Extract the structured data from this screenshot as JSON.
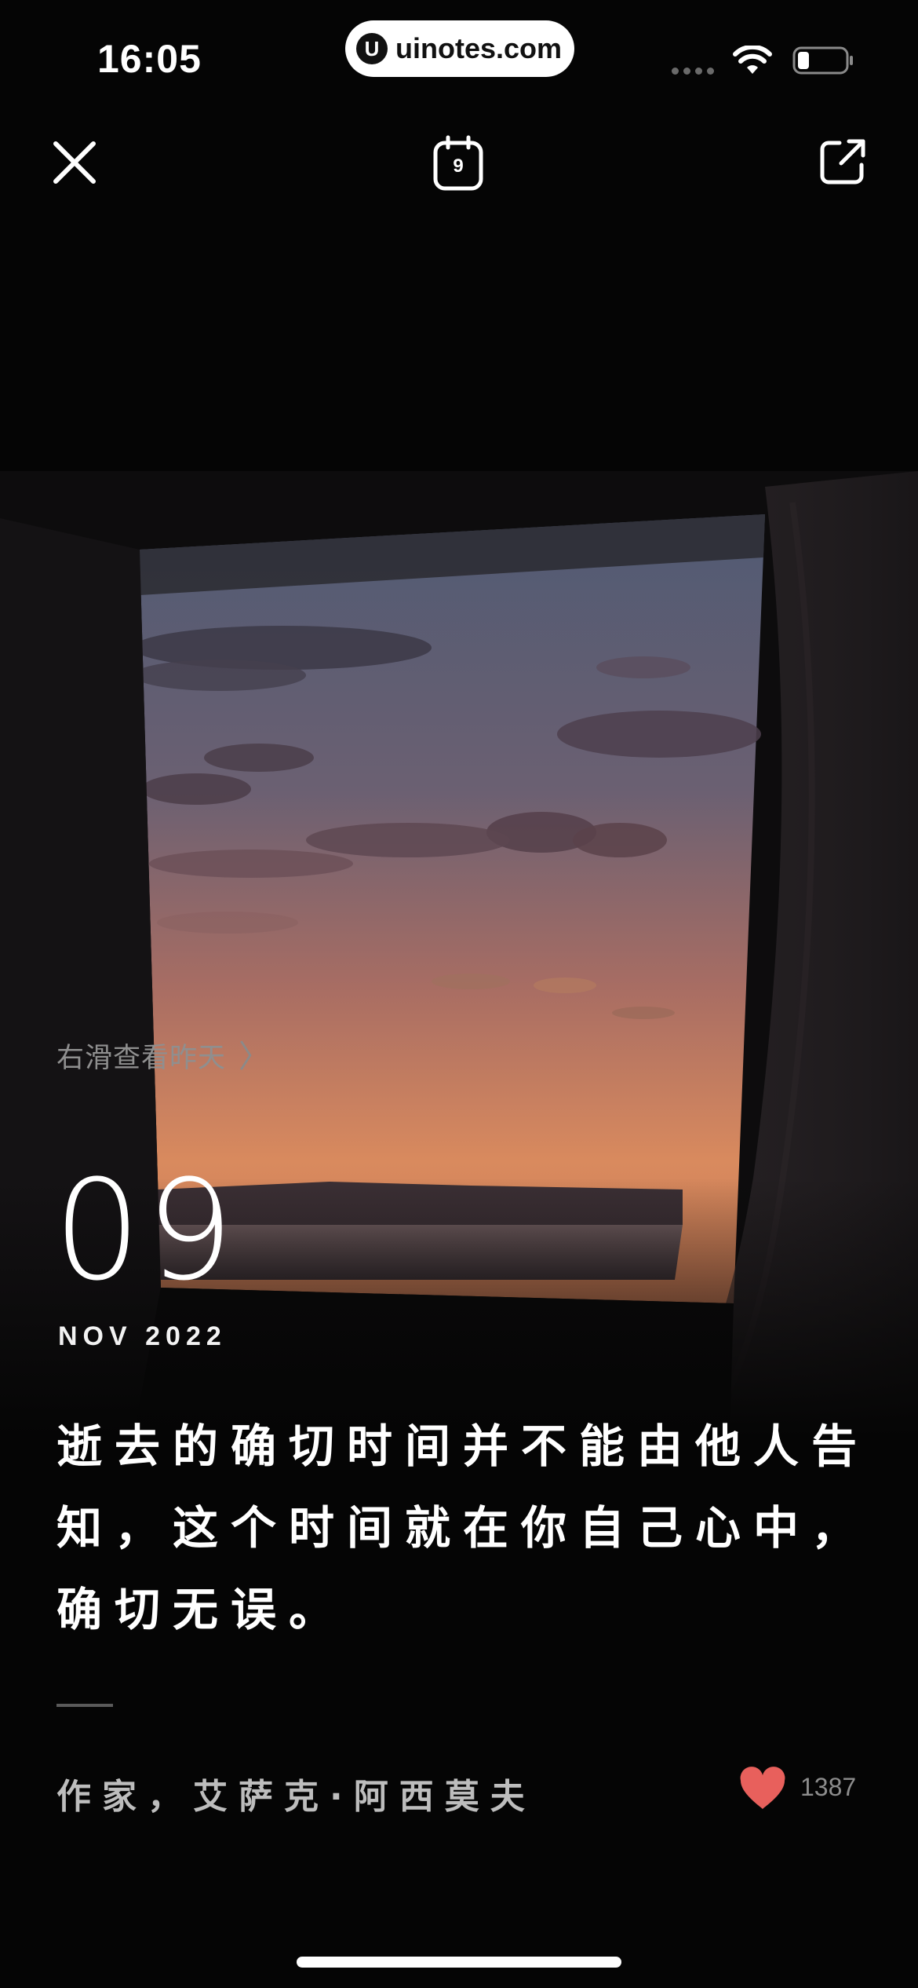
{
  "status_bar": {
    "time": "16:05",
    "watermark_logo": "U",
    "watermark_text": "uinotes.com",
    "icons": [
      "signal-dots-icon",
      "wifi-icon",
      "battery-icon"
    ]
  },
  "toolbar": {
    "close_icon": "close-icon",
    "calendar_icon": "calendar-icon",
    "calendar_day": "9",
    "share_icon": "share-icon"
  },
  "card": {
    "swipe_hint": "右滑查看昨天",
    "swipe_arrow": "〉",
    "day": "09",
    "month_year": "NOV 2022",
    "quote_lines": [
      "逝去的确切时间并不能由他人告",
      "知，这个时间就在你自己心中，",
      "确切无误。"
    ],
    "author": "作家，艾萨克·阿西莫夫",
    "like_icon": "heart-icon",
    "like_count": "1387"
  },
  "colors": {
    "background": "#050505",
    "heart": "#e8605c",
    "hint_text": "#8f8f8f",
    "author_text": "#bdbdbd"
  }
}
